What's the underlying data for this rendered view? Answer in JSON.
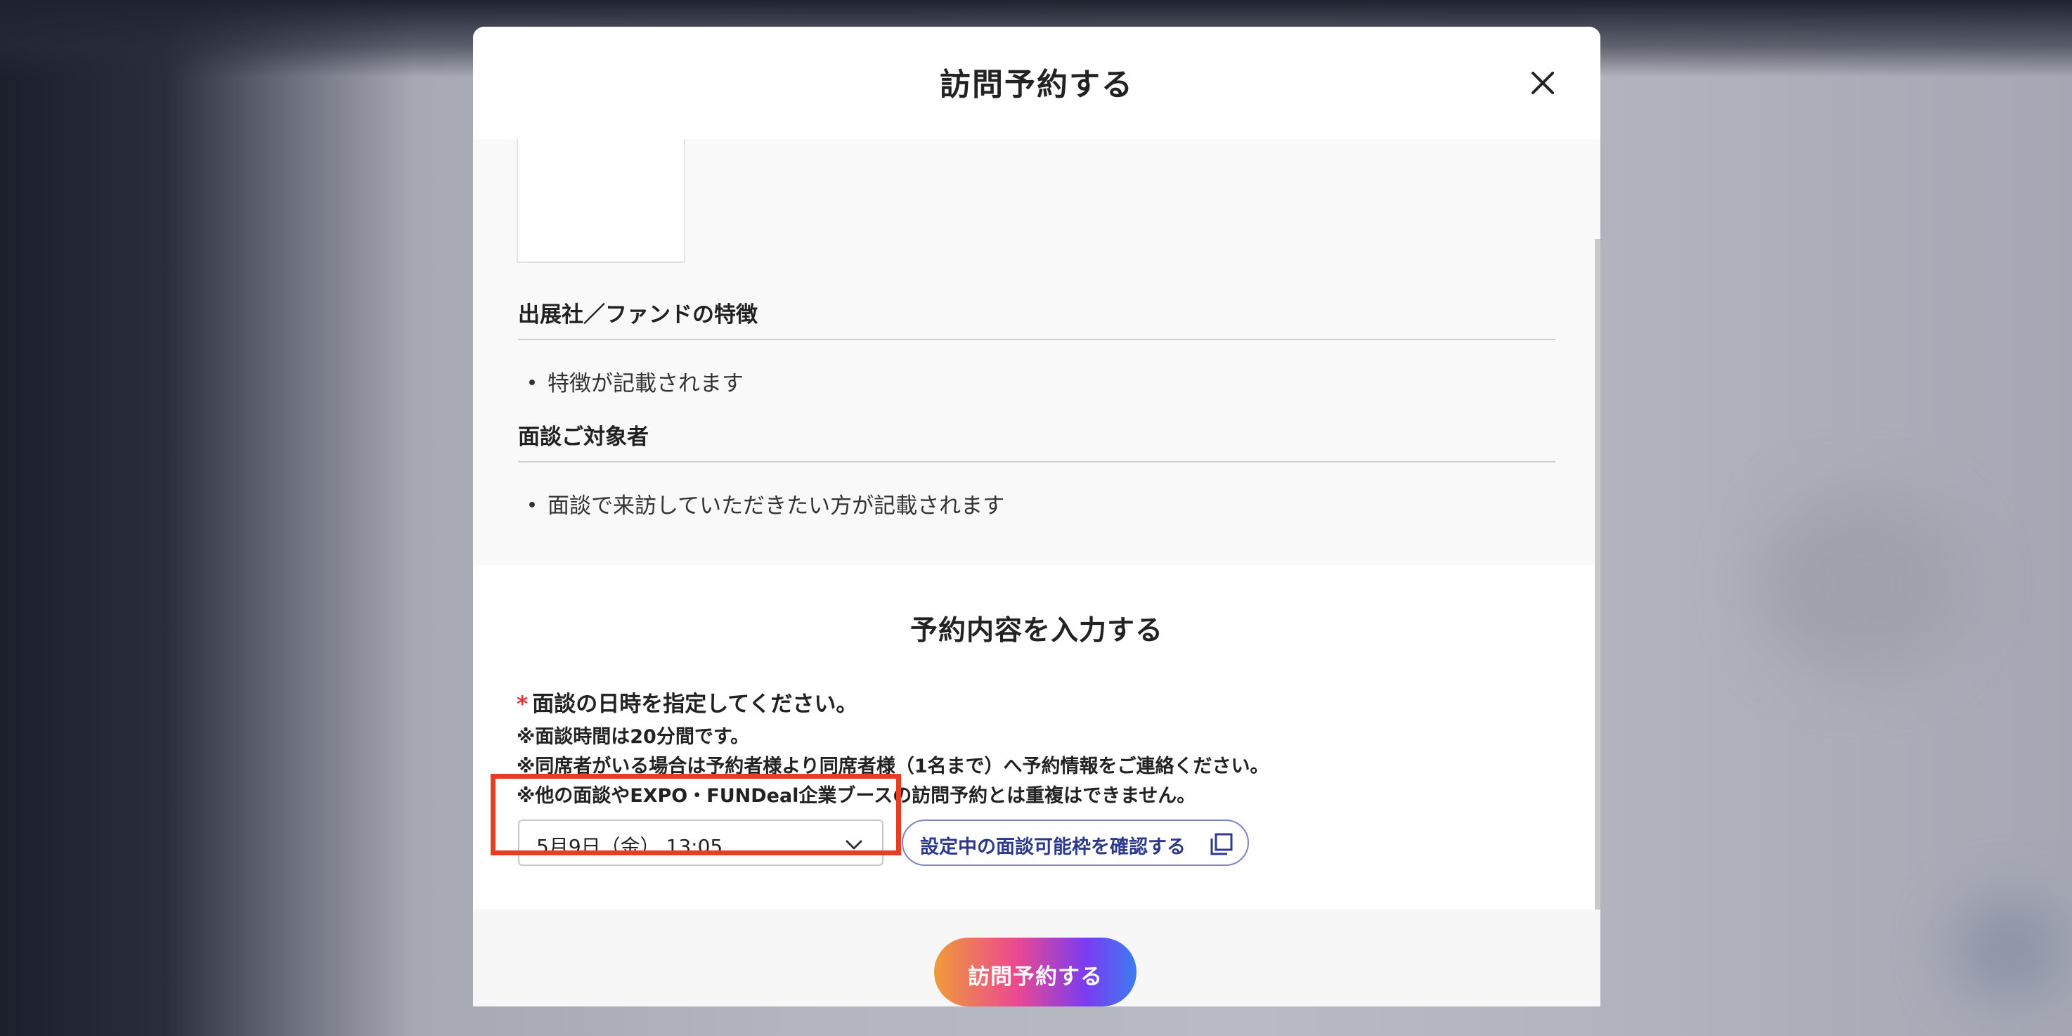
{
  "modal": {
    "title": "訪問予約する",
    "close_icon": "close-icon"
  },
  "features": {
    "heading": "出展社／ファンドの特徴",
    "items": [
      "特徴が記載されます"
    ]
  },
  "target": {
    "heading": "面談ご対象者",
    "items": [
      "面談で来訪していただきたい方が記載されます"
    ]
  },
  "form": {
    "title": "予約内容を入力する",
    "required_mark": "*",
    "datetime_label": "面談の日時を指定してください。",
    "notes": [
      "※面談時間は20分間です。",
      "※同席者がいる場合は予約者様より同席者様（1名まで）へ予約情報をご連絡ください。",
      "※他の面談やEXPO・FUNDeal企業ブースの訪問予約とは重複はできません。"
    ],
    "datetime_selected": "5月9日（金） 13:05",
    "check_slots_link": "設定中の面談可能枠を確認する"
  },
  "footer": {
    "submit_label": "訪問予約する"
  },
  "colors": {
    "required": "#e6323c",
    "link": "#2d3a8c",
    "highlight": "#e63d25"
  }
}
